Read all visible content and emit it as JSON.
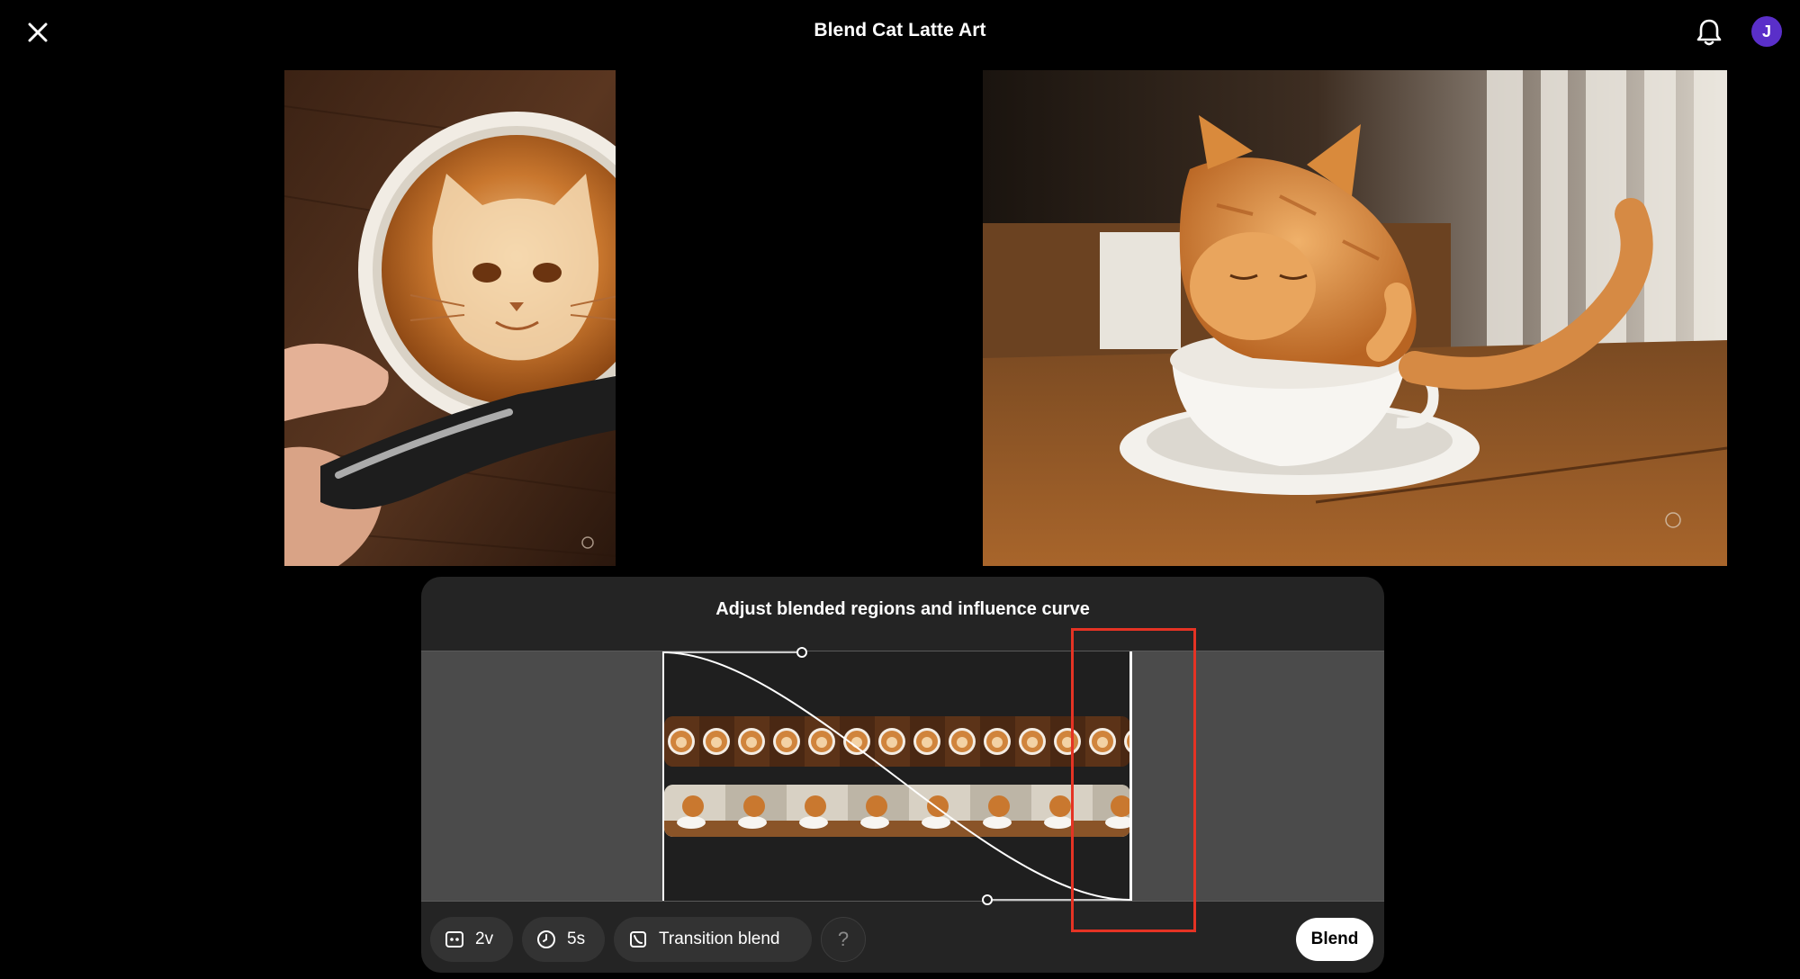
{
  "header": {
    "title": "Blend Cat Latte Art",
    "close_icon": "close-icon",
    "notification_icon": "bell-icon",
    "avatar_initial": "J",
    "avatar_color": "#5a2fc9"
  },
  "media": {
    "left_image": "latte-art-cat-image",
    "right_image": "cat-drinking-coffee-image"
  },
  "panel": {
    "title": "Adjust blended regions and influence curve"
  },
  "toolbar": {
    "videos_label": "2v",
    "videos_icon": "video-count-icon",
    "duration_label": "5s",
    "duration_icon": "clock-icon",
    "transition_label": "Transition blend",
    "transition_icon": "transition-icon",
    "help_label": "?",
    "blend_label": "Blend"
  },
  "colors": {
    "background": "#000000",
    "panel": "#242424",
    "highlight": "#e53324"
  }
}
